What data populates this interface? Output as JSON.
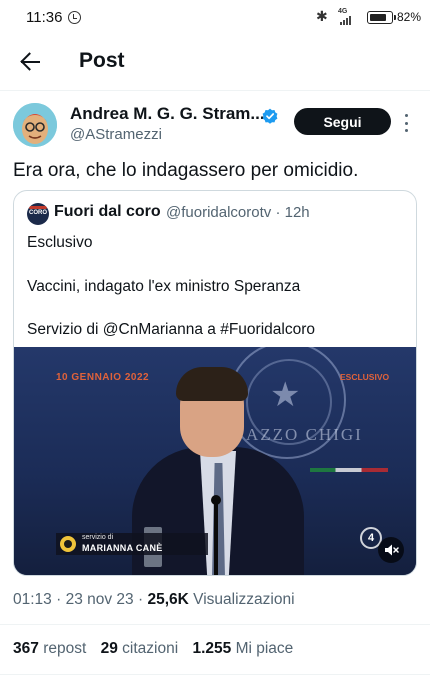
{
  "status_bar": {
    "time": "11:36",
    "network": "4G",
    "battery_percent": "82%",
    "battery_level": 0.82
  },
  "header": {
    "title": "Post"
  },
  "post": {
    "author_name": "Andrea M. G. G. Stram...",
    "author_handle": "@AStramezzi",
    "follow_label": "Segui",
    "text": "Era ora, che lo indagassero per omicidio.",
    "quoted": {
      "avatar_text": "CORO",
      "name": "Fuori dal coro",
      "handle": "@fuoridalcorotv",
      "time": "12h",
      "lines": [
        "Esclusivo",
        "Vaccini, indagato l'ex ministro Speranza",
        "Servizio di @CnMarianna a #Fuoridalcoro"
      ],
      "video": {
        "date_caption": "10 GENNAIO 2022",
        "badge": "ESCLUSIVO",
        "backdrop_text": "AZZO CHIGI",
        "lower_third_small": "servizio di",
        "lower_third_name": "MARIANNA CANÈ",
        "channel_logo": "4"
      }
    },
    "meta": {
      "time": "01:13",
      "date": "23 nov 23",
      "views_count": "25,6K",
      "views_label": "Visualizzazioni"
    },
    "stats": {
      "reposts": "367",
      "reposts_label": "repost",
      "quotes": "29",
      "quotes_label": "citazioni",
      "likes": "1.255",
      "likes_label": "Mi piace"
    }
  },
  "icons": {
    "back": "arrow-left-icon",
    "verified": "verified-badge-icon",
    "more": "more-vertical-icon",
    "mute": "volume-mute-icon",
    "alarm": "alarm-clock-icon",
    "bluetooth": "bluetooth-icon",
    "battery": "battery-icon"
  },
  "colors": {
    "verified": "#1d9bf0",
    "follow_bg": "#0f1419",
    "secondary_text": "#536471",
    "video_accent": "#e0623a"
  }
}
